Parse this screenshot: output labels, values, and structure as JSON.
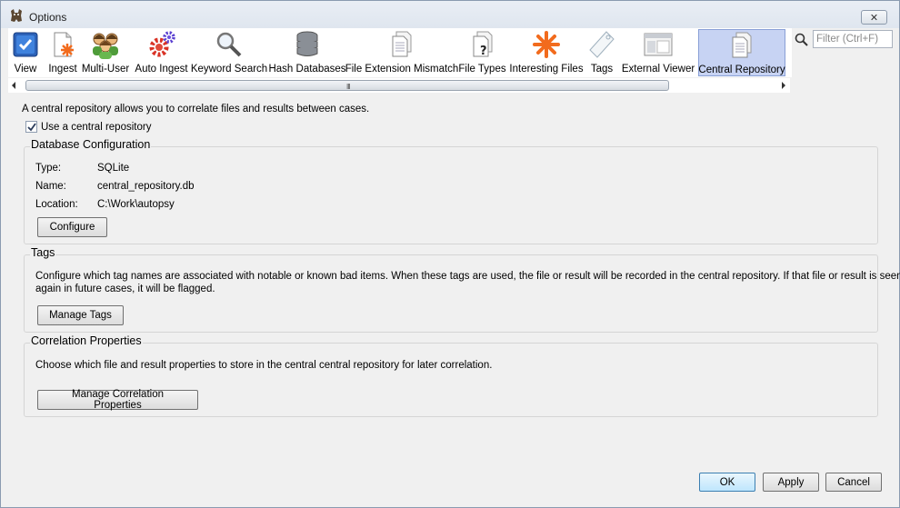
{
  "window": {
    "title": "Options",
    "close_glyph": "✕"
  },
  "toolbar": {
    "items": [
      {
        "label": "View",
        "icon": "view-icon"
      },
      {
        "label": "Ingest",
        "icon": "ingest-icon"
      },
      {
        "label": "Multi-User",
        "icon": "multi-user-icon"
      },
      {
        "label": "Auto Ingest",
        "icon": "auto-ingest-icon"
      },
      {
        "label": "Keyword Search",
        "icon": "keyword-search-icon"
      },
      {
        "label": "Hash Databases",
        "icon": "hash-databases-icon"
      },
      {
        "label": "File Extension Mismatch",
        "icon": "file-extension-mismatch-icon"
      },
      {
        "label": "File Types",
        "icon": "file-types-icon"
      },
      {
        "label": "Interesting Files",
        "icon": "interesting-files-icon"
      },
      {
        "label": "Tags",
        "icon": "tag-icon"
      },
      {
        "label": "External Viewer",
        "icon": "external-viewer-icon"
      },
      {
        "label": "Central Repository",
        "icon": "central-repository-icon"
      }
    ],
    "selected": "Central Repository",
    "filter_placeholder": "Filter (Ctrl+F)",
    "scroll_grip": "III"
  },
  "central_repository": {
    "intro": "A central repository allows you to correlate files and results between cases.",
    "use_checkbox_label": "Use a central repository",
    "use_checkbox_checked": true,
    "db_config": {
      "title": "Database Configuration",
      "type_label": "Type:",
      "type_value": "SQLite",
      "name_label": "Name:",
      "name_value": "central_repository.db",
      "location_label": "Location:",
      "location_value": "C:\\Work\\autopsy",
      "configure_button": "Configure"
    },
    "tags": {
      "title": "Tags",
      "description_line1": "Configure which tag names are associated with notable or known bad items. When these tags are used, the file or result will be recorded in the central repository. If that file or result is seen",
      "description_line2": "again in future cases, it will be flagged.",
      "manage_button": "Manage Tags"
    },
    "correlation": {
      "title": "Correlation Properties",
      "description": "Choose which file and result properties to store in the central central repository for later correlation.",
      "manage_button": "Manage Correlation Properties"
    }
  },
  "footer": {
    "ok": "OK",
    "apply": "Apply",
    "cancel": "Cancel"
  },
  "colors": {
    "selected_bg": "#c7d3f3",
    "accent_orange": "#f26b1d"
  }
}
